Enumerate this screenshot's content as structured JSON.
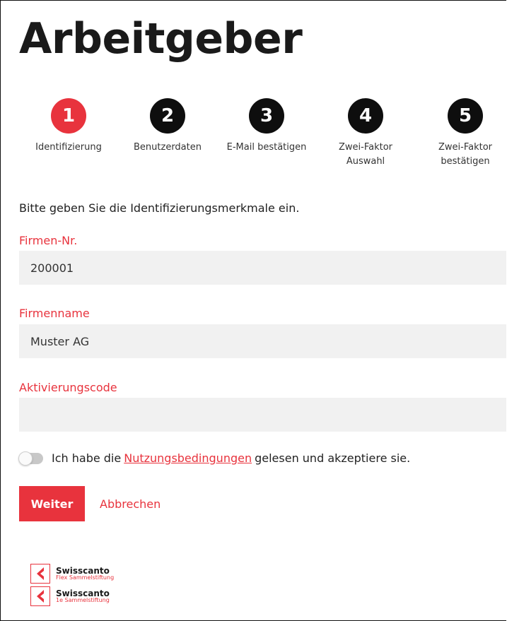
{
  "page": {
    "title": "Arbeitgeber"
  },
  "steps": [
    {
      "number": "1",
      "label": "Identifizierung",
      "active": true
    },
    {
      "number": "2",
      "label": "Benutzerdaten",
      "active": false
    },
    {
      "number": "3",
      "label": "E-Mail bestätigen",
      "active": false
    },
    {
      "number": "4",
      "label": "Zwei-Faktor\nAuswahl",
      "active": false
    },
    {
      "number": "5",
      "label": "Zwei-Faktor\nbestätigen",
      "active": false
    }
  ],
  "form": {
    "intro": "Bitte geben Sie die Identifizierungsmerkmale ein.",
    "firmen_nr": {
      "label": "Firmen-Nr.",
      "value": "200001"
    },
    "firmenname": {
      "label": "Firmenname",
      "value": "Muster AG"
    },
    "aktivierungscode": {
      "label": "Aktivierungscode",
      "value": ""
    },
    "consent": {
      "prefix": "Ich habe die",
      "link": "Nutzungsbedingungen",
      "suffix": "gelesen und akzeptiere sie.",
      "checked": false
    },
    "submit_label": "Weiter",
    "cancel_label": "Abbrechen"
  },
  "logos": [
    {
      "brand": "Swisscanto",
      "sub": "Flex Sammelstiftung"
    },
    {
      "brand": "Swisscanto",
      "sub": "1e Sammelstiftung"
    }
  ],
  "colors": {
    "accent": "#e8333d",
    "step_inactive": "#0e0e0e",
    "field_bg": "#f1f1f1"
  }
}
